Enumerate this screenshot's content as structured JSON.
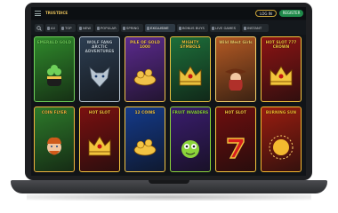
{
  "header": {
    "logo_text": "TRUSTDICE",
    "login_label": "LOG IN",
    "register_label": "REGISTER"
  },
  "categories": [
    {
      "label": "All",
      "active": false
    },
    {
      "label": "TOP",
      "active": false
    },
    {
      "label": "NEW",
      "active": false
    },
    {
      "label": "POPULAR",
      "active": false
    },
    {
      "label": "SPRING",
      "active": false
    },
    {
      "label": "EXCLUSIVE",
      "active": true
    },
    {
      "label": "BONUS BUYS",
      "active": false
    },
    {
      "label": "LIVE GAMES",
      "active": false
    },
    {
      "label": "INSTANT",
      "active": false
    }
  ],
  "games_row1": [
    {
      "title": "EMERALD GOLD",
      "bg": "#2f8a2b",
      "accent": "#6fd15a",
      "icon": "clover-pot-icon"
    },
    {
      "title": "WOLF FANG ARCTIC ADVENTURES",
      "bg": "#2d3e52",
      "accent": "#b9c6d2",
      "icon": "wolf-icon"
    },
    {
      "title": "PILE OF GOLD 1000",
      "bg": "#5b2a8e",
      "accent": "#f0c24a",
      "icon": "pile-of-gold-icon"
    },
    {
      "title": "MIGHTY SYMBOLS",
      "bg": "#1d6f3a",
      "accent": "#e9c13e",
      "icon": "crown-icon"
    },
    {
      "title": "Wild West Girls",
      "bg": "#b45a24",
      "accent": "#f5d16a",
      "icon": "cowgirl-icon"
    },
    {
      "title": "HOT SLOT 777 CROWN",
      "bg": "#8c1414",
      "accent": "#f2c53d",
      "icon": "crown-777-icon"
    }
  ],
  "games_row2": [
    {
      "title": "COIN FLYER",
      "bg": "#2d7a2a",
      "accent": "#f2b23e",
      "icon": "leprechaun-icon"
    },
    {
      "title": "HOT SLOT",
      "bg": "#7a1010",
      "accent": "#f2c53d",
      "icon": "crown-icon"
    },
    {
      "title": "12 COINS",
      "bg": "#143a8a",
      "accent": "#f3c443",
      "icon": "coins-icon"
    },
    {
      "title": "FRUIT INVADERS",
      "bg": "#3a1d6e",
      "accent": "#8bd43a",
      "icon": "fruit-monster-icon"
    },
    {
      "title": "HOT SLOT",
      "bg": "#6e0e0e",
      "accent": "#f2c53d",
      "icon": "seven-icon"
    },
    {
      "title": "BURNING SUN",
      "bg": "#9a1d10",
      "accent": "#f4b92f",
      "icon": "sun-icon"
    }
  ]
}
